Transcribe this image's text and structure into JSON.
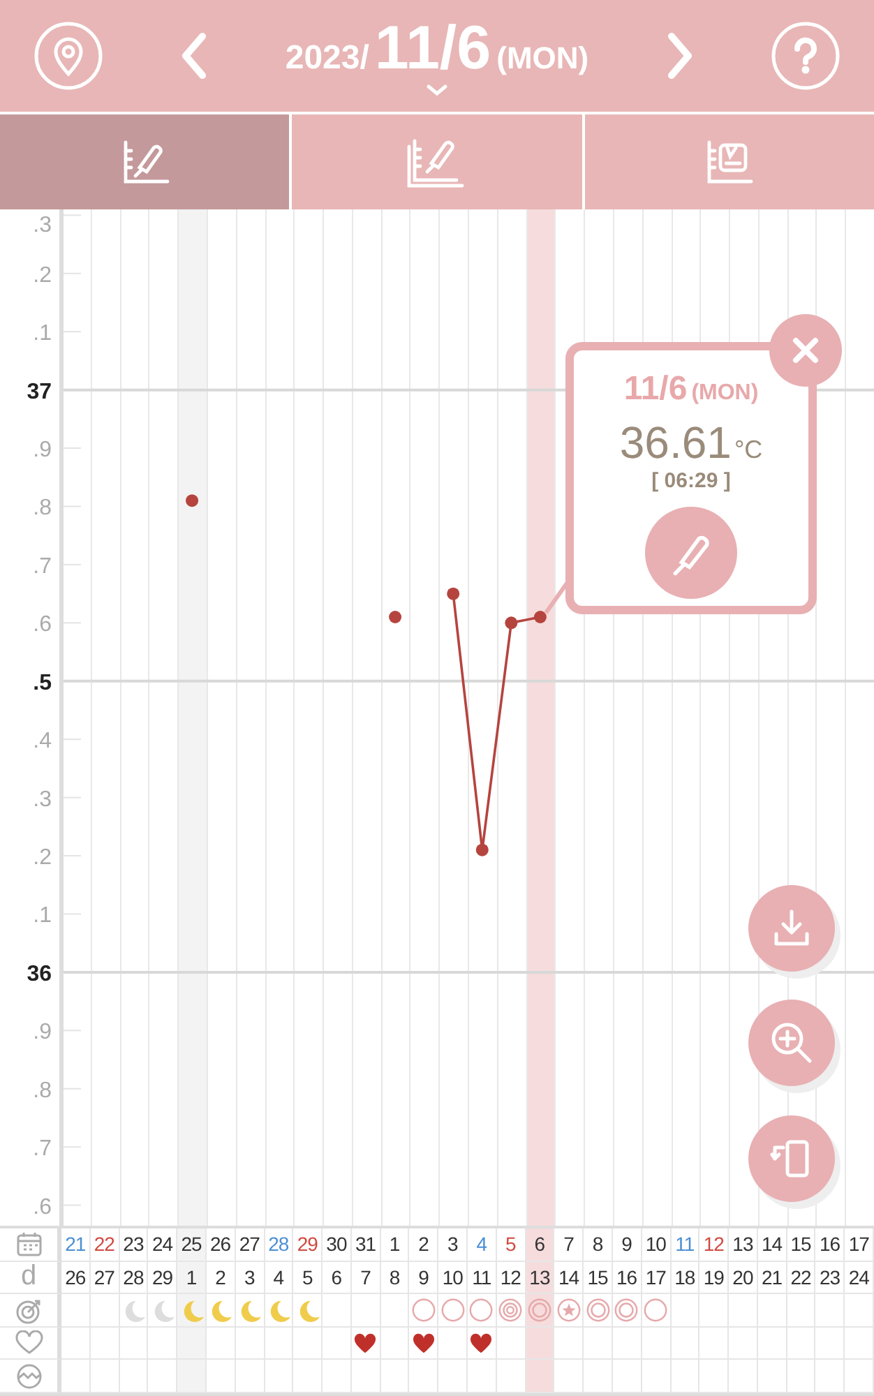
{
  "header": {
    "year": "2023/",
    "date": "11/6",
    "weekday": "(MON)"
  },
  "tabs": [
    {
      "kind": "thermometer",
      "selected": true
    },
    {
      "kind": "multi",
      "selected": false
    },
    {
      "kind": "scale",
      "selected": false
    }
  ],
  "chart": {
    "minor_labels": [
      ".3",
      ".2",
      ".1",
      ".9",
      ".8",
      ".7",
      ".6",
      ".5",
      ".4",
      ".3",
      ".2",
      ".1",
      ".9",
      ".8",
      ".7",
      ".6"
    ],
    "chart_data": {
      "type": "line",
      "grid": true,
      "series": [
        {
          "color": "#b5443f",
          "marker": "o",
          "values": [
            null,
            null,
            null,
            null,
            36.81,
            null,
            null,
            null,
            null,
            null,
            null,
            36.61,
            null,
            36.65,
            36.21,
            36.6,
            36.61,
            null,
            null,
            null,
            null,
            null,
            null,
            null,
            null,
            null,
            null,
            null
          ]
        }
      ],
      "ylim": [
        35.56,
        37.31
      ],
      "yticks": [
        37,
        36
      ]
    }
  },
  "popup": {
    "date": "11/6",
    "weekday": "(MON)",
    "temperature": "36.61",
    "unit": "°C",
    "time": "[ 06:29 ]"
  },
  "cycle_label": "d",
  "days": [
    {
      "date": "21",
      "color": "#4a8fd4",
      "cycle_day": "26",
      "heart": false,
      "shaded": false,
      "selected": false
    },
    {
      "date": "22",
      "color": "#d0493f",
      "cycle_day": "27",
      "heart": false,
      "shaded": false,
      "selected": false
    },
    {
      "date": "23",
      "color": "#333333",
      "cycle_day": "28",
      "symbol": {
        "kind": "moon",
        "color": "#dddddd"
      },
      "heart": false,
      "shaded": false,
      "selected": false
    },
    {
      "date": "24",
      "color": "#333333",
      "cycle_day": "29",
      "symbol": {
        "kind": "moon",
        "color": "#dddddd"
      },
      "heart": false,
      "shaded": false,
      "selected": false
    },
    {
      "date": "25",
      "color": "#333333",
      "cycle_day": "1",
      "symbol": {
        "kind": "moon",
        "color": "#f0cc4c"
      },
      "heart": false,
      "shaded": true,
      "selected": false
    },
    {
      "date": "26",
      "color": "#333333",
      "cycle_day": "2",
      "symbol": {
        "kind": "moon",
        "color": "#f0cc4c"
      },
      "heart": false,
      "shaded": false,
      "selected": false
    },
    {
      "date": "27",
      "color": "#333333",
      "cycle_day": "3",
      "symbol": {
        "kind": "moon",
        "color": "#f0cc4c"
      },
      "heart": false,
      "shaded": false,
      "selected": false
    },
    {
      "date": "28",
      "color": "#4a8fd4",
      "cycle_day": "4",
      "symbol": {
        "kind": "moon",
        "color": "#f0cc4c"
      },
      "heart": false,
      "shaded": false,
      "selected": false
    },
    {
      "date": "29",
      "color": "#d0493f",
      "cycle_day": "5",
      "symbol": {
        "kind": "moon",
        "color": "#f0cc4c"
      },
      "heart": false,
      "shaded": false,
      "selected": false
    },
    {
      "date": "30",
      "color": "#333333",
      "cycle_day": "6",
      "heart": false,
      "shaded": false,
      "selected": false
    },
    {
      "date": "31",
      "color": "#333333",
      "cycle_day": "7",
      "heart": true,
      "shaded": false,
      "selected": false
    },
    {
      "date": "1",
      "color": "#333333",
      "cycle_day": "8",
      "heart": false,
      "shaded": false,
      "selected": false
    },
    {
      "date": "2",
      "color": "#333333",
      "cycle_day": "9",
      "symbol": {
        "kind": "circle"
      },
      "heart": true,
      "shaded": false,
      "selected": false
    },
    {
      "date": "3",
      "color": "#333333",
      "cycle_day": "10",
      "symbol": {
        "kind": "circle"
      },
      "heart": false,
      "shaded": false,
      "selected": false
    },
    {
      "date": "4",
      "color": "#4a8fd4",
      "cycle_day": "11",
      "symbol": {
        "kind": "circle"
      },
      "heart": true,
      "shaded": false,
      "selected": false
    },
    {
      "date": "5",
      "color": "#d0493f",
      "cycle_day": "12",
      "symbol": {
        "kind": "triple_circle"
      },
      "heart": false,
      "shaded": false,
      "selected": false
    },
    {
      "date": "6",
      "color": "#333333",
      "cycle_day": "13",
      "symbol": {
        "kind": "double_circle"
      },
      "heart": false,
      "shaded": false,
      "selected": true
    },
    {
      "date": "7",
      "color": "#333333",
      "cycle_day": "14",
      "symbol": {
        "kind": "star_circle"
      },
      "heart": false,
      "shaded": false,
      "selected": false
    },
    {
      "date": "8",
      "color": "#333333",
      "cycle_day": "15",
      "symbol": {
        "kind": "double_circle"
      },
      "heart": false,
      "shaded": false,
      "selected": false
    },
    {
      "date": "9",
      "color": "#333333",
      "cycle_day": "16",
      "symbol": {
        "kind": "double_circle"
      },
      "heart": false,
      "shaded": false,
      "selected": false
    },
    {
      "date": "10",
      "color": "#333333",
      "cycle_day": "17",
      "symbol": {
        "kind": "circle"
      },
      "heart": false,
      "shaded": false,
      "selected": false
    },
    {
      "date": "11",
      "color": "#4a8fd4",
      "cycle_day": "18",
      "heart": false,
      "shaded": false,
      "selected": false
    },
    {
      "date": "12",
      "color": "#d0493f",
      "cycle_day": "19",
      "heart": false,
      "shaded": false,
      "selected": false
    },
    {
      "date": "13",
      "color": "#333333",
      "cycle_day": "20",
      "heart": false,
      "shaded": false,
      "selected": false
    },
    {
      "date": "14",
      "color": "#333333",
      "cycle_day": "21",
      "heart": false,
      "shaded": false,
      "selected": false
    },
    {
      "date": "15",
      "color": "#333333",
      "cycle_day": "22",
      "heart": false,
      "shaded": false,
      "selected": false
    },
    {
      "date": "16",
      "color": "#333333",
      "cycle_day": "23",
      "heart": false,
      "shaded": false,
      "selected": false
    },
    {
      "date": "17",
      "color": "#333333",
      "cycle_day": "24",
      "heart": false,
      "shaded": false,
      "selected": false
    }
  ]
}
